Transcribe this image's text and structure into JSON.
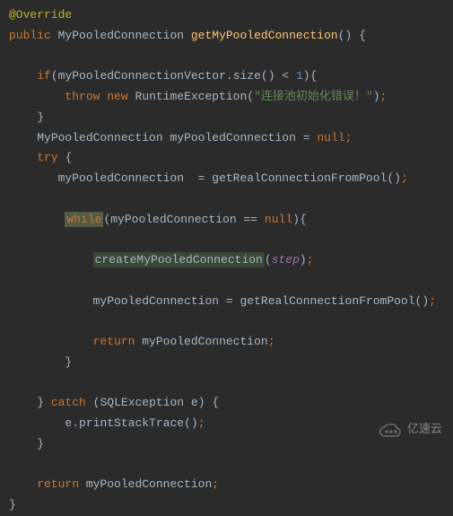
{
  "code": {
    "annotation": "@Override",
    "kw_public": "public",
    "type_mypooled": "MyPooledConnection",
    "method_name": "getMyPooledConnection",
    "kw_if": "if",
    "var_vector": "myPooledConnectionVector",
    "call_size": "size",
    "op_lt": "<",
    "num_one": "1",
    "kw_throw": "throw",
    "kw_new": "new",
    "type_runtime": "RuntimeException",
    "str_exception": "\"连接池初始化错误！\"",
    "var_mypooled": "myPooledConnection",
    "op_eq": "=",
    "kw_null": "null",
    "kw_try": "try",
    "call_getreal": "getRealConnectionFromPool",
    "kw_while": "while",
    "op_eqeq": "==",
    "call_create": "createMyPooledConnection",
    "param_step": "step",
    "kw_return": "return",
    "kw_catch": "catch",
    "type_sqlex": "SQLException",
    "var_e": "e",
    "call_print": "printStackTrace",
    "lparen": "(",
    "rparen": ")",
    "lbrace": "{",
    "rbrace": "}",
    "dot": ".",
    "semi": ";"
  },
  "watermark": {
    "text": "亿速云"
  }
}
